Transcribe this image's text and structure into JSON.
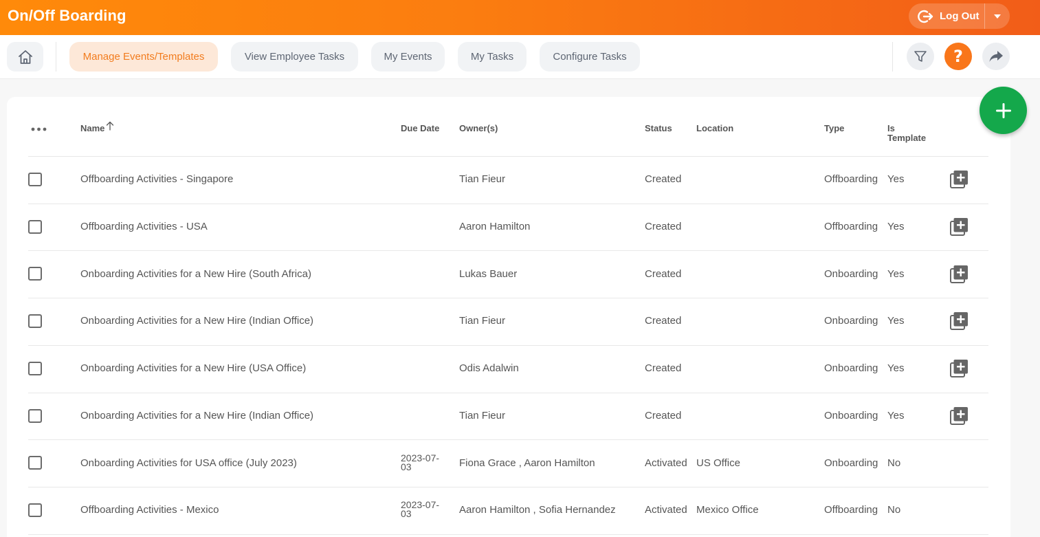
{
  "header": {
    "title": "On/Off Boarding",
    "logout_label": "Log Out",
    "accent_color": "#f9761a"
  },
  "nav": {
    "tabs": [
      {
        "label": "Manage Events/Templates",
        "active": true
      },
      {
        "label": "View Employee Tasks",
        "active": false
      },
      {
        "label": "My Events",
        "active": false
      },
      {
        "label": "My Tasks",
        "active": false
      },
      {
        "label": "Configure Tasks",
        "active": false
      }
    ],
    "icons": [
      "home-icon",
      "filter-icon",
      "help-icon",
      "share-icon"
    ],
    "help_glyph": "?"
  },
  "table": {
    "columns": {
      "name": "Name",
      "due_date": "Due Date",
      "owners": "Owner(s)",
      "status": "Status",
      "location": "Location",
      "type": "Type",
      "is_template_line1": "Is",
      "is_template_line2": "Template"
    },
    "rows": [
      {
        "name": "Offboarding Activities - Singapore",
        "due_date_1": "",
        "due_date_2": "",
        "owners": "Tian Fieur",
        "status": "Created",
        "location": "",
        "type": "Offboarding",
        "is_template": "Yes"
      },
      {
        "name": "Offboarding Activities - USA",
        "due_date_1": "",
        "due_date_2": "",
        "owners": "Aaron Hamilton",
        "status": "Created",
        "location": "",
        "type": "Offboarding",
        "is_template": "Yes"
      },
      {
        "name": "Onboarding Activities for a New Hire (South Africa)",
        "due_date_1": "",
        "due_date_2": "",
        "owners": "Lukas Bauer",
        "status": "Created",
        "location": "",
        "type": "Onboarding",
        "is_template": "Yes"
      },
      {
        "name": "Onboarding Activities for a New Hire (Indian Office)",
        "due_date_1": "",
        "due_date_2": "",
        "owners": "Tian Fieur",
        "status": "Created",
        "location": "",
        "type": "Onboarding",
        "is_template": "Yes"
      },
      {
        "name": "Onboarding Activities for a New Hire (USA Office)",
        "due_date_1": "",
        "due_date_2": "",
        "owners": "Odis Adalwin",
        "status": "Created",
        "location": "",
        "type": "Onboarding",
        "is_template": "Yes"
      },
      {
        "name": "Onboarding Activities for a New Hire (Indian Office)",
        "due_date_1": "",
        "due_date_2": "",
        "owners": "Tian Fieur",
        "status": "Created",
        "location": "",
        "type": "Onboarding",
        "is_template": "Yes"
      },
      {
        "name": "Onboarding Activities for USA office (July 2023)",
        "due_date_1": "2023-07-",
        "due_date_2": "03",
        "owners": "Fiona Grace , Aaron Hamilton",
        "status": "Activated",
        "location": "US Office",
        "type": "Onboarding",
        "is_template": "No"
      },
      {
        "name": "Offboarding Activities - Mexico",
        "due_date_1": "2023-07-",
        "due_date_2": "03",
        "owners": "Aaron Hamilton , Sofia Hernandez",
        "status": "Activated",
        "location": "Mexico Office",
        "type": "Offboarding",
        "is_template": "No"
      }
    ]
  },
  "fab": {
    "icon": "plus-icon",
    "color": "#14a84b"
  }
}
